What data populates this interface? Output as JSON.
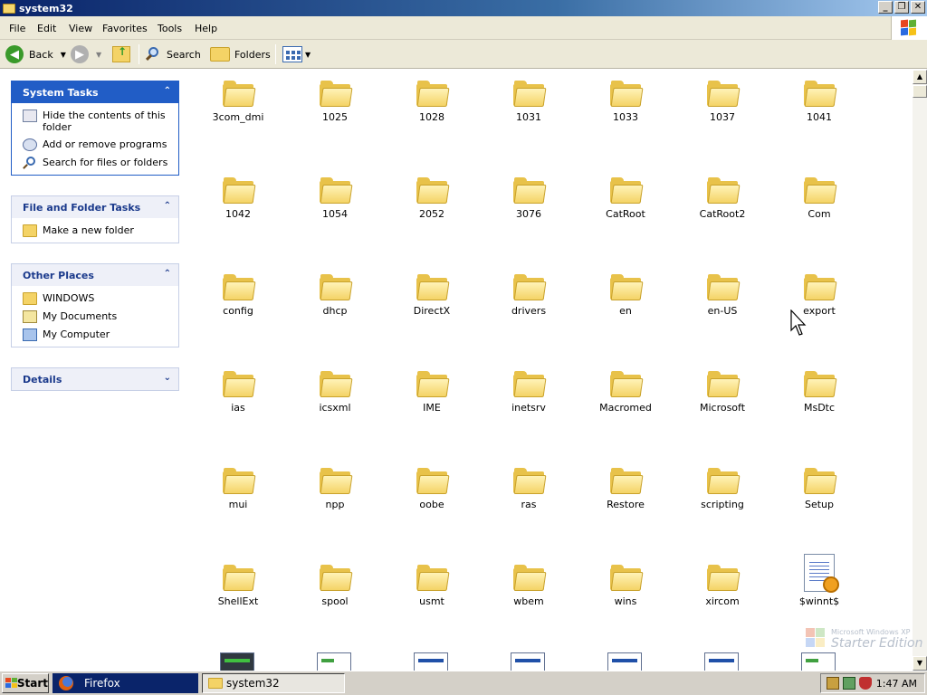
{
  "window": {
    "title": "system32",
    "buttons": {
      "minimize": "_",
      "maximize": "❐",
      "close": "✕"
    }
  },
  "menu": [
    "File",
    "Edit",
    "View",
    "Favorites",
    "Tools",
    "Help"
  ],
  "toolbar": {
    "back_label": "Back",
    "search_label": "Search",
    "folders_label": "Folders"
  },
  "left_pane": {
    "system_tasks": {
      "title": "System Tasks",
      "items": [
        "Hide the contents of this folder",
        "Add or remove programs",
        "Search for files or folders"
      ]
    },
    "file_folder_tasks": {
      "title": "File and Folder Tasks",
      "items": [
        "Make a new folder"
      ]
    },
    "other_places": {
      "title": "Other Places",
      "items": [
        "WINDOWS",
        "My Documents",
        "My Computer"
      ]
    },
    "details": {
      "title": "Details"
    }
  },
  "items": [
    [
      "3com_dmi",
      "1025",
      "1028",
      "1031",
      "1033",
      "1037",
      "1041"
    ],
    [
      "1042",
      "1054",
      "2052",
      "3076",
      "CatRoot",
      "CatRoot2",
      "Com"
    ],
    [
      "config",
      "dhcp",
      "DirectX",
      "drivers",
      "en",
      "en-US",
      "export"
    ],
    [
      "ias",
      "icsxml",
      "IME",
      "inetsrv",
      "Macromed",
      "Microsoft",
      "MsDtc"
    ],
    [
      "mui",
      "npp",
      "oobe",
      "ras",
      "Restore",
      "scripting",
      "Setup"
    ],
    [
      "ShellExt",
      "spool",
      "usmt",
      "wbem",
      "wins",
      "xircom",
      "$winnt$"
    ]
  ],
  "watermark": {
    "line1": "Microsoft Windows XP",
    "line2": "Starter Edition"
  },
  "taskbar": {
    "start_label": "Start",
    "tasks": [
      "Firefox",
      "system32"
    ],
    "clock": "1:47 AM"
  },
  "colors": {
    "title_bar": "#0a246a",
    "panel_head_text": "#215dc6",
    "folder_yellow": "#f4d366",
    "taskbar_active": "#0a246a"
  }
}
